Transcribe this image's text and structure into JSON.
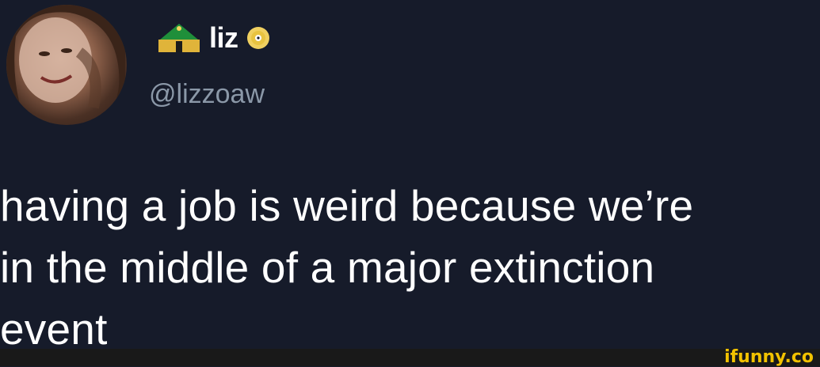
{
  "tweet": {
    "display_name": "liz",
    "handle": "@lizzoaw",
    "text": "having a job is weird because we’re\nin the middle of a major extinction\nevent",
    "name_badge_icon": "crown-icon",
    "verified_icon": "cd-disc-icon"
  },
  "footer": {
    "watermark": "ifunny.co"
  },
  "colors": {
    "background": "#161b2a",
    "text": "#ffffff",
    "handle": "#8b98a8",
    "watermark": "#f2c200"
  }
}
